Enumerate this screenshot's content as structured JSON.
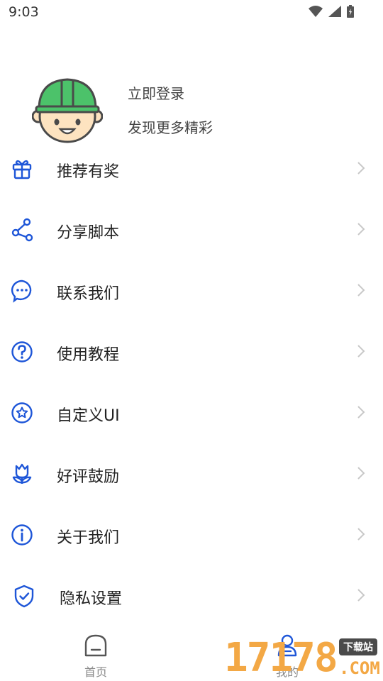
{
  "status_bar": {
    "time": "9:03"
  },
  "profile": {
    "login_label": "立即登录",
    "subtitle": "发现更多精彩"
  },
  "menu": {
    "items": [
      {
        "label": "推荐有奖",
        "icon": "gift-icon"
      },
      {
        "label": "分享脚本",
        "icon": "share-icon"
      },
      {
        "label": "联系我们",
        "icon": "chat-icon"
      },
      {
        "label": "使用教程",
        "icon": "help-icon"
      },
      {
        "label": "自定义UI",
        "icon": "star-badge-icon"
      },
      {
        "label": "好评鼓励",
        "icon": "flower-icon"
      },
      {
        "label": "关于我们",
        "icon": "info-icon"
      },
      {
        "label": "隐私设置",
        "icon": "shield-icon"
      }
    ]
  },
  "bottom_nav": {
    "home_label": "首页",
    "me_label": "我的"
  },
  "watermark": {
    "digits": "17178",
    "badge": "下载站",
    "domain": ".COM"
  },
  "colors": {
    "accent": "#1e56d8",
    "avatar_helmet": "#4cc26a",
    "watermark": "#f3a845"
  }
}
